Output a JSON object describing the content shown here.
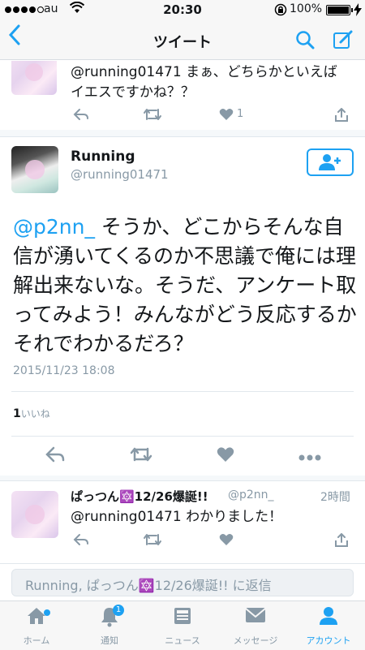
{
  "status_bar": {
    "carrier": "au",
    "time": "20:30",
    "battery_percent": "100%"
  },
  "nav": {
    "title": "ツイート"
  },
  "previous_reply": {
    "text": "@running01471 まぁ、どちらかといえば イエスですかね？？",
    "like_count": "1"
  },
  "tweet": {
    "display_name": "Running",
    "username": "@running01471",
    "mention": "@p2nn_",
    "body": " そうか、どこからそんな自信が湧いてくるのか不思議で俺には理解出来ないな。そうだ、アンケート取ってみよう！みんながどう反応するかそれでわかるだろ？",
    "timestamp": "2015/11/23 18:08",
    "likes_count": "1",
    "likes_label": "いいね"
  },
  "reply": {
    "display_name": "ぱっつん🔯12/26爆誕!!",
    "username": "@p2nn_",
    "time_ago": "2時間",
    "text": "@running01471 わかりました！"
  },
  "composer": {
    "placeholder": "Running, ぱっつん🔯12/26爆誕!! に返信"
  },
  "tabs": [
    {
      "label": "ホーム",
      "icon": "home-icon"
    },
    {
      "label": "通知",
      "icon": "bell-icon",
      "badge": "1"
    },
    {
      "label": "ニュース",
      "icon": "news-icon"
    },
    {
      "label": "メッセージ",
      "icon": "envelope-icon"
    },
    {
      "label": "アカウント",
      "icon": "person-icon",
      "active": true
    }
  ],
  "colors": {
    "accent": "#1da1f2",
    "muted": "#8899a6",
    "text": "#14171a",
    "like_active": "#8899a6"
  }
}
